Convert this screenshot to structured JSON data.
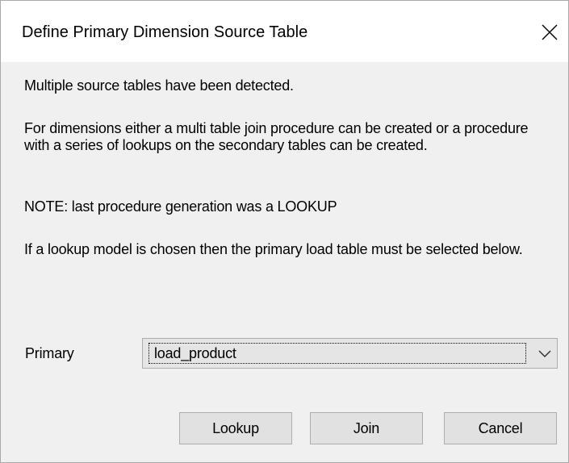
{
  "dialog": {
    "title": "Define Primary Dimension Source Table",
    "close_icon": "close-icon"
  },
  "message": {
    "line1": "Multiple source tables have been detected.",
    "line2": "For dimensions either a multi table join procedure can be created or a procedure with a series of lookups on the secondary tables can be created.",
    "line3": "NOTE: last procedure generation was a LOOKUP",
    "line4": "If a lookup model is chosen then the primary load table must be selected below."
  },
  "primary": {
    "label": "Primary",
    "selected_value": "load_product",
    "dropdown_icon": "chevron-down-icon"
  },
  "buttons": {
    "lookup": "Lookup",
    "join": "Join",
    "cancel": "Cancel"
  }
}
